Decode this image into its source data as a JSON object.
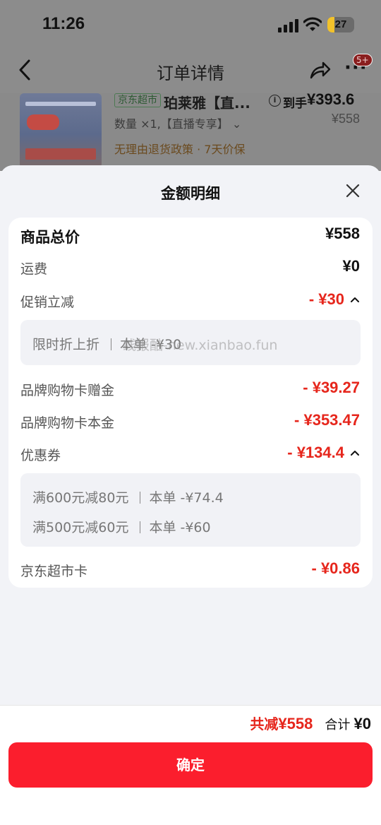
{
  "status_bar": {
    "time": "11:26",
    "battery": "27",
    "icons": [
      "signal-icon",
      "wifi-icon",
      "battery-icon"
    ]
  },
  "nav": {
    "title": "订单详情",
    "badge": "5+",
    "icons": [
      "back-icon",
      "share-icon",
      "more-icon"
    ]
  },
  "product": {
    "store_tag": "京东超市",
    "name": "珀莱雅【直...",
    "price_label": "到手",
    "price": "¥393.6",
    "original_price": "¥558",
    "quantity": "数量 ×1,【直播专享】",
    "policy": "无理由退货政策 · 7天价保"
  },
  "sheet": {
    "title": "金额明细",
    "rows": {
      "total": {
        "label": "商品总价",
        "value": "¥558"
      },
      "shipping": {
        "label": "运费",
        "value": "¥0"
      },
      "promo": {
        "label": "促销立减",
        "value": "- ¥30"
      },
      "promo_detail": {
        "name": "限时折上折",
        "amount": "本单 -¥30"
      },
      "gift_card_bonus": {
        "label": "品牌购物卡赠金",
        "value": "- ¥39.27"
      },
      "gift_card_principal": {
        "label": "品牌购物卡本金",
        "value": "- ¥353.47"
      },
      "coupon": {
        "label": "优惠券",
        "value": "- ¥134.4"
      },
      "coupon_details": [
        {
          "name": "满600元减80元",
          "amount": "本单 -¥74.4"
        },
        {
          "name": "满500元减60元",
          "amount": "本单 -¥60"
        }
      ],
      "market_card": {
        "label": "京东超市卡",
        "value": "- ¥0.86"
      }
    },
    "watermark": "线报酷-new.xianbao.fun"
  },
  "footer": {
    "saved_label": "共减",
    "saved_value": "¥558",
    "total_label": "合计",
    "total_value": "¥0",
    "confirm_label": "确定"
  },
  "colors": {
    "accent_red": "#e6261c",
    "button_red": "#fb1e2d",
    "dim_overlay": "#8c8c8c"
  }
}
